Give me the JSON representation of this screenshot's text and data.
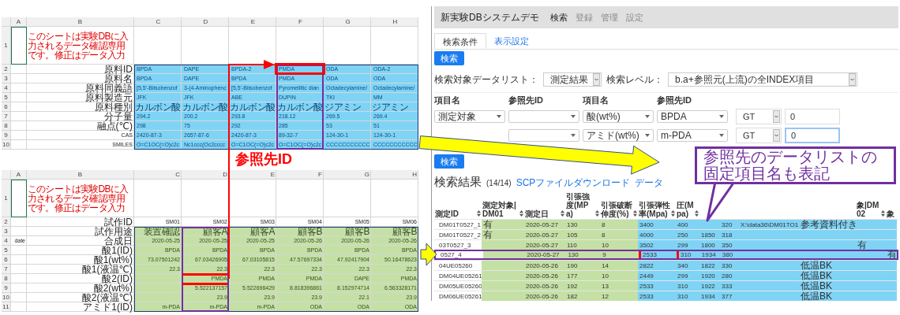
{
  "sheets": [
    {
      "color": "#7fd4f6",
      "columns": [
        "A",
        "B",
        "C",
        "D",
        "E",
        "F",
        "G",
        "H"
      ],
      "rows": [
        {
          "number": "1",
          "label": "このシートは実験DBに入力されるデータ確認専用です。修正はデータ入力",
          "filled": false
        },
        {
          "number": "2",
          "label": "原料ID",
          "filled": true,
          "cells": [
            "BPDA",
            "DAPE",
            "BPDA-2",
            "PMDA",
            "ODA",
            "ODA-2"
          ]
        },
        {
          "number": "3",
          "label": "原料名",
          "filled": true,
          "cells": [
            "BPDA",
            "DAPE",
            "BPDA",
            "PMDA",
            "ODA",
            "ODA"
          ]
        },
        {
          "number": "4",
          "label": "原料同義語",
          "filled": true,
          "cells": [
            "[5,5'-Biisobenzof",
            "3-(4-Aminophenc",
            "[5,5'-Biisobenzof",
            "Pyromellitic dian",
            "Octadecylamine/",
            "Octadecylamine/"
          ]
        },
        {
          "number": "5",
          "label": "原料製造元",
          "filled": true,
          "cells": [
            "JFK",
            "JFK",
            "ABE",
            "DUPIN",
            "TKI",
            "MM"
          ]
        },
        {
          "number": "6",
          "label": "原料種別",
          "filled": true,
          "cells": [
            "カルボン酸",
            "カルボン酸",
            "カルボン酸",
            "カルボン酸",
            "ジアミン",
            "ジアミン"
          ]
        },
        {
          "number": "7",
          "label": "分子量",
          "filled": true,
          "cells": [
            "294.2",
            "200.2",
            "293.8",
            "218.12",
            "269.5",
            "269.4"
          ]
        },
        {
          "number": "8",
          "label": "融点(℃)",
          "filled": true,
          "cells": [
            "298",
            "75",
            "292",
            "285",
            "53",
            "51"
          ]
        },
        {
          "number": "9",
          "label": "CAS",
          "filled": true,
          "cells": [
            "2420-87-3",
            "2657-87-6",
            "2420-87-3",
            "89-32-7",
            "124-30-1",
            "124-30-1"
          ]
        },
        {
          "number": "10",
          "label": "SMILES",
          "filled": true,
          "cells": [
            "O=C1OC(=O)c2c",
            "Nc1ccc(Oc2cccc",
            "O=C1OC(=O)c2c",
            "O=C1OC(=O)c2c",
            "CCCCCCCCCCC",
            "CCCCCCCCCCC"
          ]
        }
      ]
    },
    {
      "color": "#c5e0a5",
      "columns": [
        "A",
        "B",
        "C",
        "D",
        "E",
        "F",
        "G",
        "H"
      ],
      "rows": [
        {
          "number": "1",
          "label": "このシートは実験DBに入力されるデータ確認専用です。修正はデータ入力",
          "filled": false
        },
        {
          "number": "2",
          "label": "試作ID",
          "filled": false,
          "cells": [
            "SM01",
            "SM02",
            "SM03",
            "SM04",
            "SM05",
            "SM06"
          ]
        },
        {
          "number": "3",
          "label": "試作用途",
          "filled": true,
          "cells": [
            "装置確認",
            "顧客A",
            "顧客A",
            "顧客B",
            "顧客B",
            "顧客B"
          ]
        },
        {
          "number": "4",
          "col_a": "date",
          "label": "合成日",
          "filled": true,
          "cells": [
            "2020-05-25",
            "2020-05-25",
            "2020-05-25",
            "2020-05-26",
            "2020-05-26",
            "2020-05-26"
          ]
        },
        {
          "number": "5",
          "label": "酸1(ID)",
          "filled": true,
          "cells": [
            "BPDA",
            "BPDA",
            "BPDA",
            "BPDA",
            "BPDA",
            "BPDA"
          ]
        },
        {
          "number": "6",
          "label": "酸1(wt%)",
          "filled": true,
          "cells": [
            "73.07501242",
            "67.03426905",
            "67.03105815",
            "47.57697334",
            "47.92417904",
            "50.16478623"
          ]
        },
        {
          "number": "7",
          "label": "酸1(液温℃)",
          "filled": true,
          "cells": [
            "22.3",
            "22.3",
            "22.3",
            "22.3",
            "22.3",
            "22.3"
          ]
        },
        {
          "number": "8",
          "label": "酸2(ID)",
          "filled": true,
          "cells": [
            null,
            "PMDA",
            "PMDA",
            "PMDA",
            "DAPE",
            "PMDA"
          ]
        },
        {
          "number": "9",
          "label": "酸2(wt%)",
          "filled": true,
          "cells": [
            null,
            "5.522137157",
            "5.522696429",
            "8.818396861",
            "8.152974714",
            "6.563328171"
          ]
        },
        {
          "number": "10",
          "label": "酸2(液温℃)",
          "filled": true,
          "cells": [
            null,
            "23.9",
            "23.9",
            "23.9",
            "22.1",
            "23.9"
          ]
        },
        {
          "number": "11",
          "label": "アミド1(ID)",
          "filled": true,
          "cells": [
            "m-PDA",
            "m-PDA",
            "m-PDA",
            "ODA",
            "ODA",
            "ODA"
          ]
        }
      ]
    }
  ],
  "reference_label": "参照先ID",
  "app": {
    "brand": "新実験DBシステムデモ",
    "nav": [
      {
        "label": "検索",
        "selected": true
      },
      {
        "label": "登録",
        "selected": false
      },
      {
        "label": "管理",
        "selected": false
      },
      {
        "label": "設定",
        "selected": false
      }
    ],
    "tabs": [
      {
        "label": "検索条件",
        "selected": true
      },
      {
        "label": "表示設定",
        "selected": false
      }
    ],
    "search_button": "検索",
    "filters": [
      {
        "label": "検索対象データリスト：",
        "value": "測定結果"
      },
      {
        "label": "検索レベル：",
        "value": "b.a+参照元(上流)の全INDEX項目"
      }
    ],
    "condition_headers": [
      "項目名",
      "参照先ID",
      "項目名",
      "参照先ID"
    ],
    "conditions": [
      {
        "item_1": "測定対象",
        "item_2": "酸(wt%)",
        "ref_2": "BPDA",
        "operator": "GT",
        "value": "0",
        "focused": false
      },
      {
        "item_2": "アミド(wt%)",
        "ref_2": "m-PDA",
        "operator": "GT",
        "value": "0",
        "focused": true
      }
    ],
    "search_button_2": "検索",
    "results": {
      "title": "検索結果",
      "count": "(14/14)",
      "links": [
        "SCPファイルダウンロード",
        "データ"
      ],
      "columns": [
        {
          "label": "測定ID"
        },
        {
          "label": "測定対象|DM01",
          "color": "#c5e0a5"
        },
        {
          "label": "測定日",
          "color": "#c5e0a5"
        },
        {
          "label": "引張強度(MPa)",
          "color": "#c5e0a5"
        },
        {
          "label": "引張破断伸度(%)",
          "color": "#c5e0a5"
        },
        {
          "label": "引張弾性率(Mpa)",
          "color": "#7fd4f6"
        },
        {
          "label": "圧(Mpa)",
          "color": "#7fd4f6"
        },
        {
          "color": "#7fd4f6"
        },
        {
          "color": "#7fd4f6"
        },
        {
          "color": "#7fd4f6"
        },
        {
          "color": "#7fd4f6"
        },
        {
          "label": "象|DM02",
          "color": "#7fd4f6"
        },
        {
          "label": "象",
          "color": "#7fd4f6"
        }
      ],
      "rows": [
        {
          "selected": false,
          "cells": [
            "DM01T0527_1",
            "有",
            "2020-05-27",
            "130",
            "8",
            "3400",
            "400",
            null,
            "320",
            "X:\\data36\\DM01TO1",
            "参考資料付き",
            null,
            null
          ]
        },
        {
          "selected": false,
          "cells": [
            "DM01T0527_2",
            "有",
            "2020-05-27",
            "105",
            "8",
            "4000",
            "250",
            "1850",
            "318",
            null,
            null,
            null,
            null
          ]
        },
        {
          "selected": false,
          "cells": [
            "03T0527_3",
            null,
            "2020-05-27",
            "110",
            "10",
            "3502",
            "299",
            "1800",
            "350",
            null,
            null,
            "有",
            null
          ]
        },
        {
          "selected": true,
          "cells": [
            "0527_4",
            null,
            "2020-05-27",
            "130",
            "9",
            "2533",
            "310",
            "1934",
            "380",
            null,
            null,
            null,
            "有"
          ]
        },
        {
          "selected": false,
          "cells": [
            "04UE05260",
            null,
            "2020-05-26",
            "190",
            "14",
            "2822",
            "340",
            "1822",
            "330",
            null,
            "低温BK",
            null,
            null
          ]
        },
        {
          "selected": false,
          "cells": [
            "DM04UE05261",
            null,
            "2020-05-26",
            "177",
            "10",
            "2449",
            "299",
            "1920",
            "280",
            null,
            "低温BK",
            null,
            null
          ]
        },
        {
          "selected": false,
          "cells": [
            "DM05UE05260",
            null,
            "2020-05-26",
            "192",
            "13",
            "2533",
            "310",
            "1922",
            "333",
            null,
            "低温BK",
            null,
            null
          ]
        },
        {
          "selected": false,
          "cells": [
            "DM06UE05261",
            null,
            "2020-05-26",
            "182",
            "12",
            "2533",
            "310",
            "1934",
            "377",
            null,
            "低温BK",
            null,
            null
          ]
        }
      ]
    }
  },
  "callout": [
    "参照先のデータリストの",
    "固定項目名も表記"
  ]
}
